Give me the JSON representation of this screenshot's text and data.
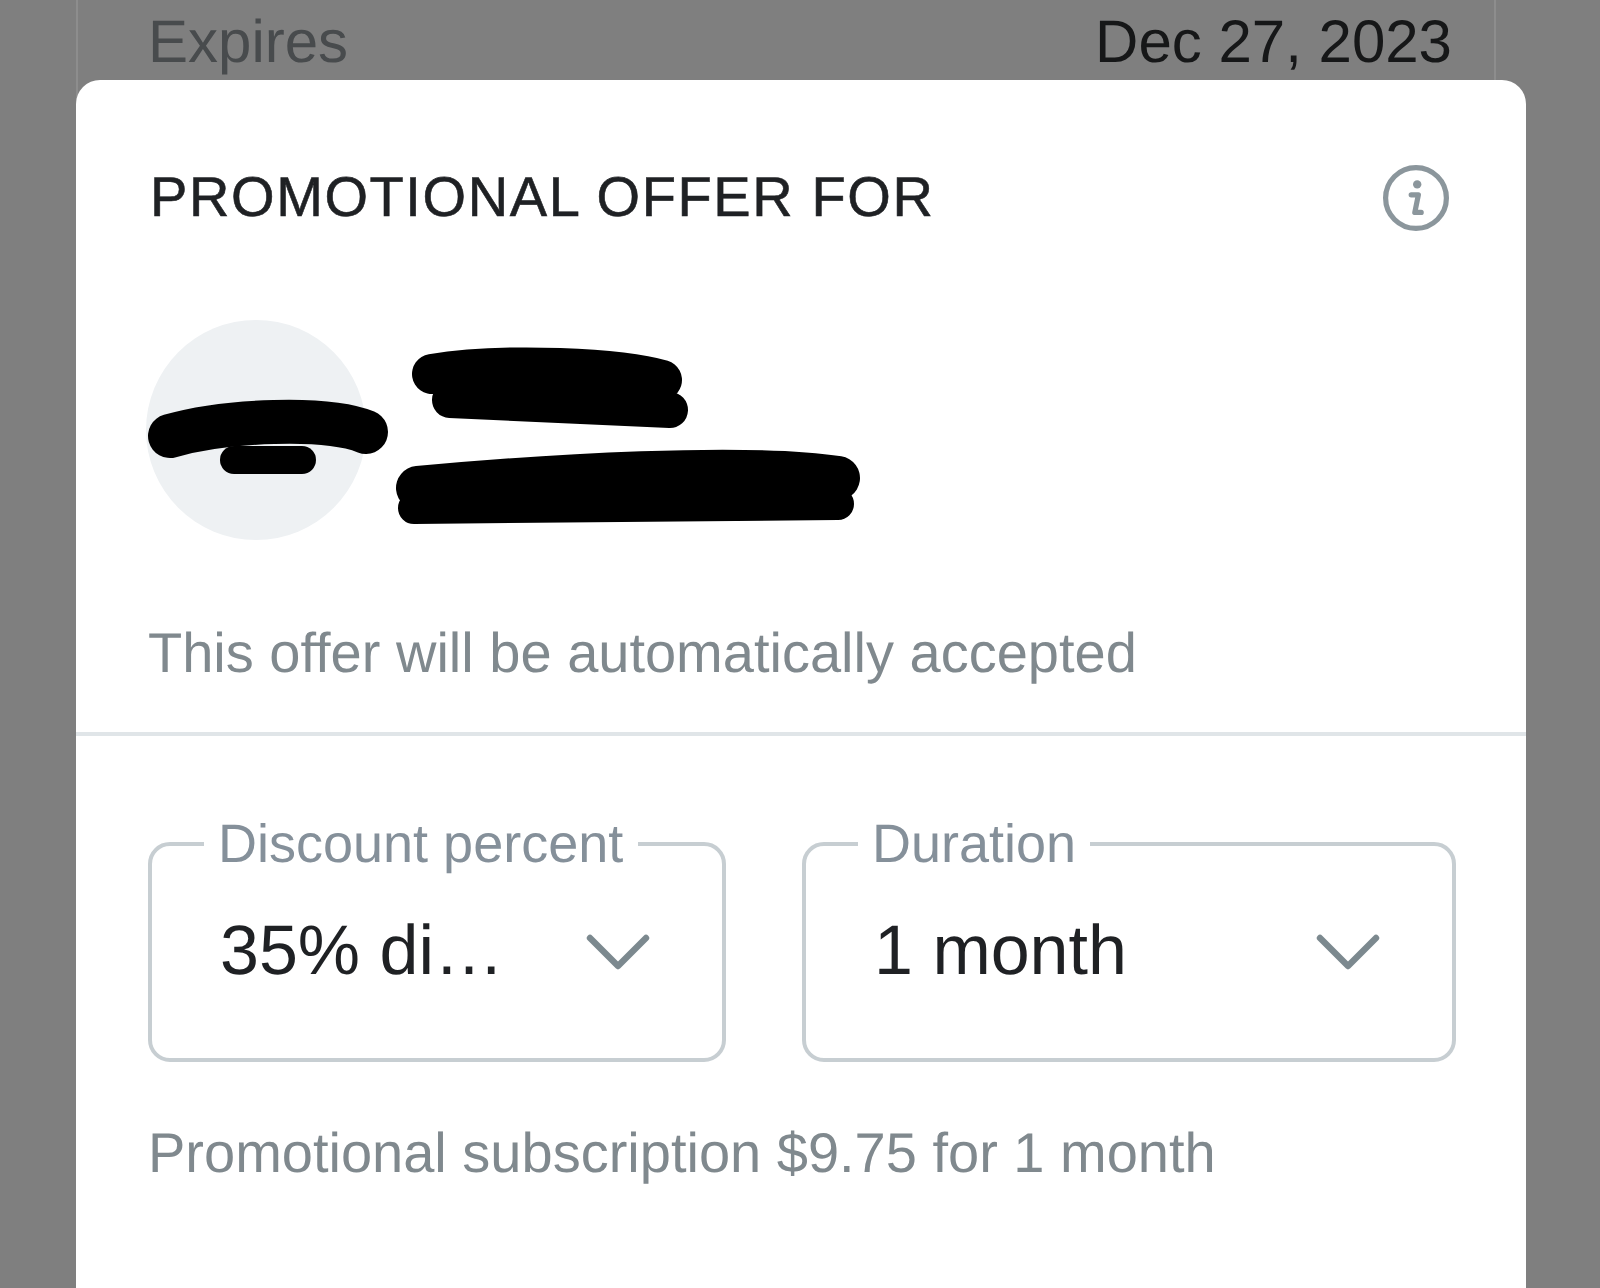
{
  "background": {
    "label": "Expires",
    "value": "Dec 27, 2023"
  },
  "dialog": {
    "title": "PROMOTIONAL OFFER FOR",
    "notice": "This offer will be automatically accepted",
    "fields": [
      {
        "label": "Discount percent",
        "value": "35% di…"
      },
      {
        "label": "Duration",
        "value": "1 month"
      }
    ],
    "summary": "Promotional subscription $9.75 for 1 month"
  }
}
